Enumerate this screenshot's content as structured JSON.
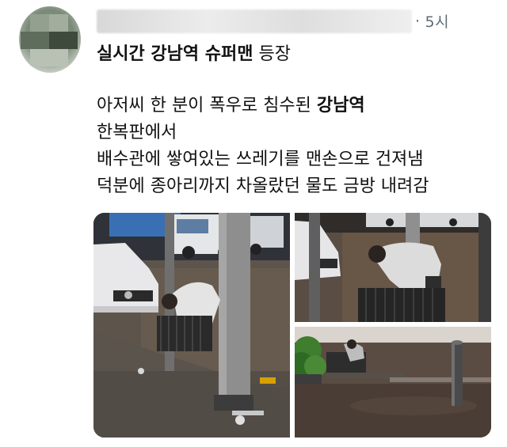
{
  "post": {
    "meta_dots": "·",
    "time": "5시",
    "title_bold": "실시간 강남역 슈퍼맨",
    "title_rest": " 등장",
    "lines": [
      {
        "pre": "아저씨 한 분이 폭우로 침수된 ",
        "bold": "강남역"
      },
      {
        "pre": "한복판에서",
        "bold": ""
      },
      {
        "pre": "배수관에 쌓여있는 쓰레기를 맨손으로 건져냄",
        "bold": ""
      },
      {
        "pre": "덕분에 종아리까지 차올랐던 물도 금방 내려감",
        "bold": ""
      }
    ]
  },
  "icons": {
    "avatar": "blurred-avatar",
    "username": "blurred-username"
  },
  "colors": {
    "meta_text": "#5f6b73",
    "text": "#111111"
  }
}
